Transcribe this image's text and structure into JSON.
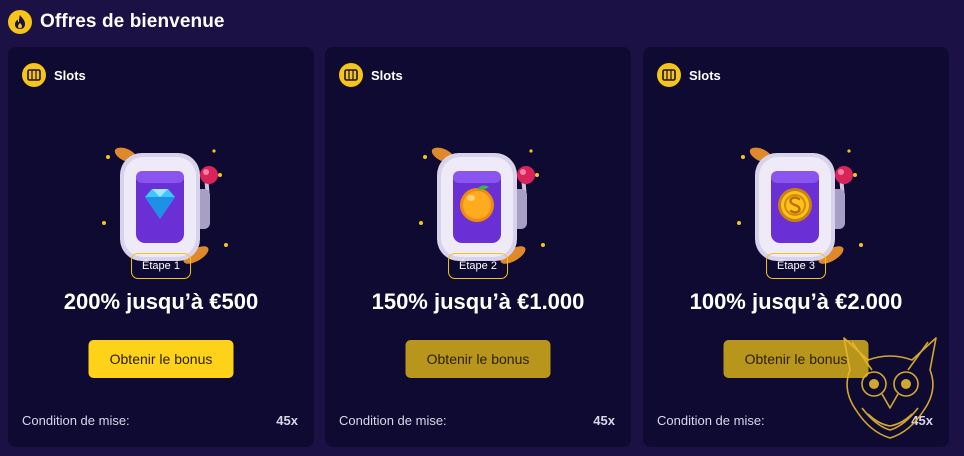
{
  "header": {
    "title": "Offres de bienvenue",
    "icon": "fire-icon"
  },
  "cards": [
    {
      "category": "Slots",
      "category_icon": "slot-machine-icon",
      "symbol": "diamond",
      "step": "Étape 1",
      "offer": "200% jusqu’à €500",
      "cta": "Obtenir le bonus",
      "wager_label": "Condition de mise:",
      "wager_value": "45x"
    },
    {
      "category": "Slots",
      "category_icon": "slot-machine-icon",
      "symbol": "orange",
      "step": "Étape 2",
      "offer": "150% jusqu’à €1.000",
      "cta": "Obtenir le bonus",
      "wager_label": "Condition de mise:",
      "wager_value": "45x"
    },
    {
      "category": "Slots",
      "category_icon": "slot-machine-icon",
      "symbol": "coin",
      "step": "Étape 3",
      "offer": "100% jusqu’à €2.000",
      "cta": "Obtenir le bonus",
      "wager_label": "Condition de mise:",
      "wager_value": "45x"
    }
  ],
  "colors": {
    "background": "#1b1145",
    "card": "#0f0a32",
    "accent": "#ffd21a",
    "accent_dim": "#b8961b",
    "machine_frame": "#d8d2ea",
    "reel": "#6b2fd6"
  }
}
